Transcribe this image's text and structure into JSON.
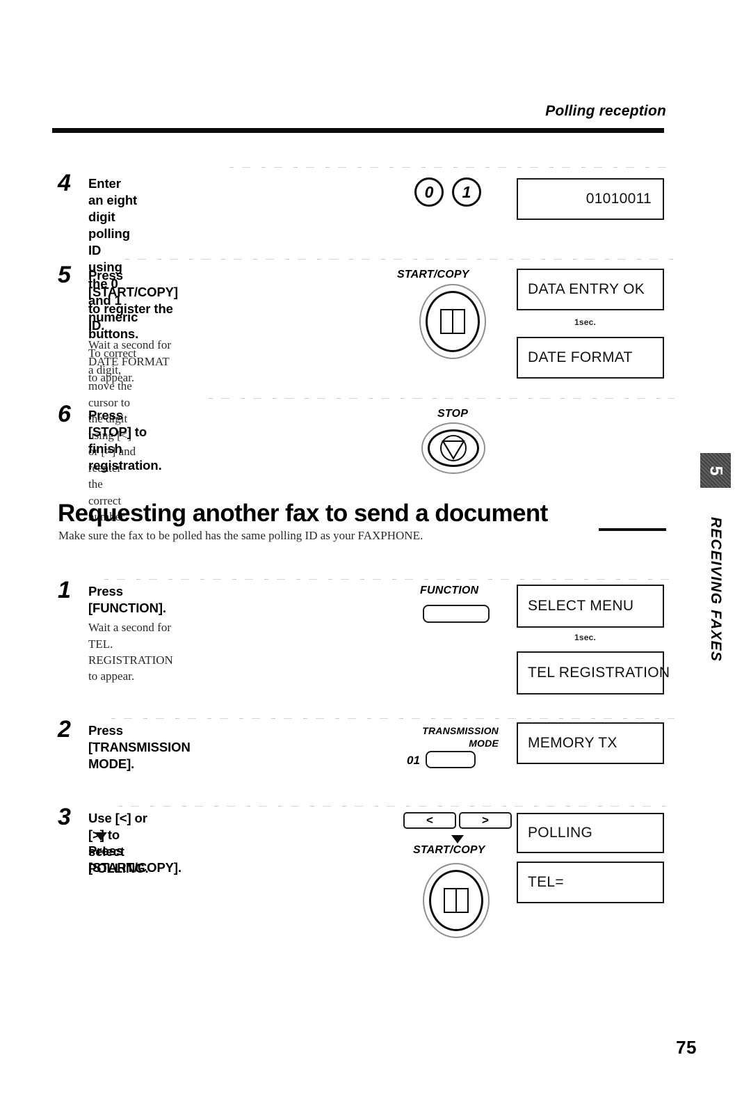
{
  "header": {
    "title": "Polling reception"
  },
  "folio": {
    "page_number": "75"
  },
  "side_tab": {
    "chapter_number": "5",
    "chapter_name": "RECEIVING FAXES"
  },
  "section_heading": {
    "title": "Requesting another fax to send a document",
    "intro": "Make sure the fax to be polled has the same polling ID as your FAXPHONE."
  },
  "steps_top": [
    {
      "number": "4",
      "title": "Enter an eight digit polling ID using the 0 and 1 numeric buttons.",
      "sub": "To correct a digit, move the cursor to the digit using [<] or [>] and reenter the correct number.",
      "keys": {
        "key0": "0",
        "key1": "1"
      },
      "display": {
        "line1": "01010011"
      }
    },
    {
      "number": "5",
      "title": "Press [START/COPY] to register the ID.",
      "sub": "Wait a second for DATE FORMAT to appear.",
      "keys": {
        "start_copy_label": "START/COPY"
      },
      "display": {
        "line1": "DATA ENTRY OK",
        "delay": "1sec.",
        "line2": "DATE FORMAT"
      }
    },
    {
      "number": "6",
      "title": "Press [STOP] to finish registration.",
      "sub": "",
      "keys": {
        "stop_label": "STOP"
      },
      "display": {}
    }
  ],
  "steps_bottom": [
    {
      "number": "1",
      "title": "Press [FUNCTION].",
      "sub": "Wait a second for TEL. REGISTRATION to appear.",
      "keys": {
        "function_label": "FUNCTION"
      },
      "display": {
        "line1": "SELECT MENU",
        "delay": "1sec.",
        "line2": "TEL REGISTRATION"
      }
    },
    {
      "number": "2",
      "title": "Press [TRANSMISSION MODE].",
      "sub": "",
      "keys": {
        "transmission_label_line1": "TRANSMISSION",
        "transmission_label_line2": "MODE",
        "code": "01"
      },
      "display": {
        "line1": "MEMORY TX"
      }
    },
    {
      "number": "3",
      "title": "Use [<] or [>] to select POLLING.",
      "title2": "Press [START/COPY].",
      "sub": "",
      "keys": {
        "left_arrow": "<",
        "right_arrow": ">",
        "start_copy_label": "START/COPY"
      },
      "display": {
        "line1": "POLLING",
        "line2": "TEL="
      }
    }
  ]
}
